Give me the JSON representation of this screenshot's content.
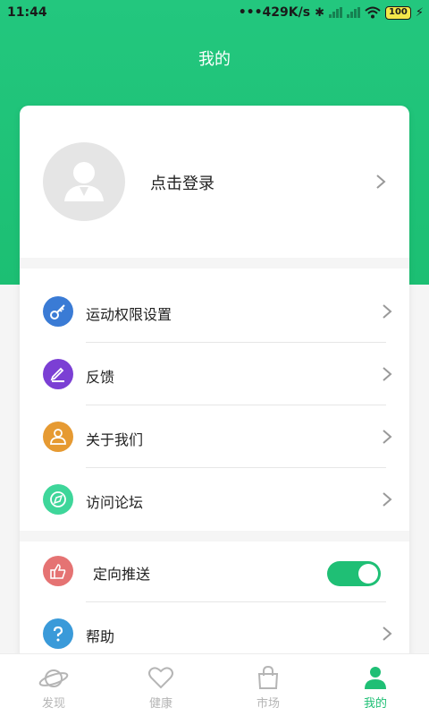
{
  "status_bar": {
    "time": "11:44",
    "network_speed": "•••429K/s",
    "battery": "100"
  },
  "header": {
    "title": "我的"
  },
  "profile": {
    "login_label": "点击登录"
  },
  "menu_group_1": [
    {
      "label": "运动权限设置",
      "icon": "key-icon",
      "color": "#3a7bd5"
    },
    {
      "label": "反馈",
      "icon": "pen-icon",
      "color": "#7b3fd4"
    },
    {
      "label": "关于我们",
      "icon": "person-icon",
      "color": "#e69a32"
    },
    {
      "label": "访问论坛",
      "icon": "compass-icon",
      "color": "#3ed69a"
    }
  ],
  "menu_group_2": [
    {
      "label": "定向推送",
      "icon": "thumbs-up-icon",
      "color": "#e57373",
      "toggle": true
    },
    {
      "label": "帮助",
      "icon": "question-icon",
      "color": "#3a9ad9"
    }
  ],
  "tabs": [
    {
      "label": "发现",
      "icon": "planet-icon",
      "active": false
    },
    {
      "label": "健康",
      "icon": "heart-icon",
      "active": false
    },
    {
      "label": "市场",
      "icon": "bag-icon",
      "active": false
    },
    {
      "label": "我的",
      "icon": "user-icon",
      "active": true
    }
  ],
  "colors": {
    "accent": "#1fbf75",
    "header_green": "#23c77e"
  }
}
